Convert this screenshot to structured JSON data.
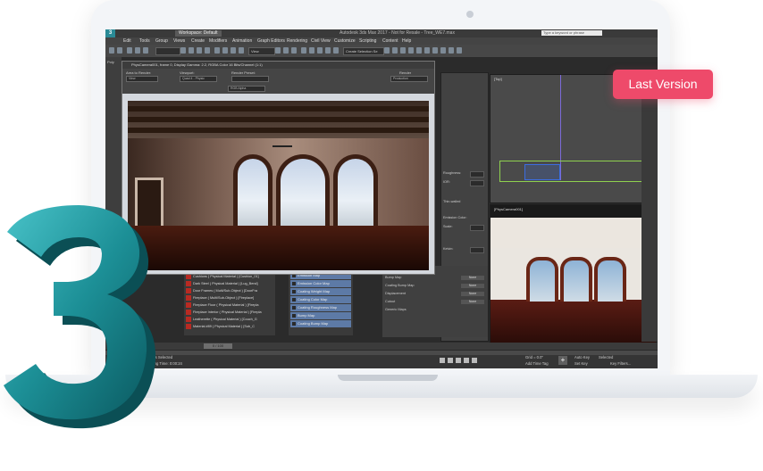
{
  "badge": {
    "label": "Last Version"
  },
  "app": {
    "title": "Autodesk 3ds Max 2017 - Not for Resale - Tree_WE7.max",
    "workspace": "Workspace: Default",
    "search_placeholder": "Type a keyword or phrase",
    "logo_text": "3"
  },
  "menu": [
    "Edit",
    "Tools",
    "Group",
    "Views",
    "Create",
    "Modifiers",
    "Animation",
    "Graph Editors",
    "Rendering",
    "Civil View",
    "Customize",
    "Scripting",
    "Content",
    "Help"
  ],
  "toolbar": {
    "view_dropdown": "View",
    "selection_set": "Create Selection Se"
  },
  "leftbar": {
    "label": "Poly"
  },
  "render_window": {
    "title": "PhysCamera001, frame 0, Display Gamma: 2.2, RGBA Color 16 Bits/Channel (1:1)",
    "area_label": "Area to Render:",
    "area_value": "View",
    "viewport_label": "Viewport:",
    "viewport_value": "Quad 4 - Physic",
    "preset_label": "Render Preset:",
    "render_button": "Render",
    "production_value": "Production",
    "channel_value": "RGB Alpha"
  },
  "materials": [
    "Cushions ( Physical Material ) [Cushion_01]",
    "Dark Steel ( Physical Material ) [Lug_Bend]",
    "Door Frames ( Multi/Sub-Object ) [DoorFra",
    "Fireplace ( Multi/Sub-Object ) [Fireplace]",
    "Fireplace Floor ( Physical Material ) [Firepla",
    "Fireplace Interior ( Physical Material ) [Firepla",
    "Leatherette ( Physical Material ) [Couch_G",
    "Material #89 ( Physical Material ) [Sub_C"
  ],
  "maps": [
    "Emission Map",
    "Emission Color Map",
    "Coating Weight Map",
    "Coating Color Map",
    "Coating Roughness Map",
    "Bump Map",
    "Coating Bump Map"
  ],
  "material_editor": {
    "roughness_label": "Roughness:",
    "roughness_value": "0.0",
    "ior_label": "IOR:",
    "ior_value": "1.5",
    "thin_walled": "Thin-walled",
    "emission_label": "Emission Color:",
    "scale_label": "Scale:",
    "kelvin_label": "Kelvin:",
    "kelvin_value": "6500",
    "rows": [
      {
        "label": "Bump Map",
        "value": "0.3",
        "button": "None"
      },
      {
        "label": "Coating Bump Map",
        "value": "0.3",
        "button": "None"
      },
      {
        "label": "Displacement",
        "value": "1.0",
        "button": "None"
      },
      {
        "label": "Cutout",
        "value": "",
        "button": "None"
      }
    ],
    "generic_maps": "Generic Maps",
    "special_maps": "Special Maps"
  },
  "viewports": {
    "top_label": "[Top]",
    "persp_label": "[PhysCamera001]"
  },
  "status": {
    "selection": "0 Objects Selected",
    "render_time": "Rendering Time: 0:00:24",
    "rendering_finished": "Rendering finished",
    "frame": "0 / 100",
    "grid": "Grid = 0.0\"",
    "add_time_tag": "Add Time Tag",
    "auto_key": "Auto Key",
    "selected": "Selected",
    "set_key": "Set Key",
    "key_filters": "Key Filters...",
    "max_script": "MAXScript Mi"
  }
}
